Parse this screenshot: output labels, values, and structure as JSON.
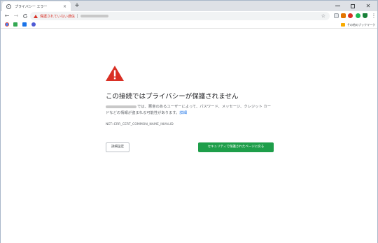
{
  "tab": {
    "title": "プライバシー エラー",
    "close": "×"
  },
  "new_tab": "+",
  "toolbar": {
    "back": "←",
    "forward": "→",
    "reload": "C",
    "security_text": "保護されていない通信",
    "star": "☆",
    "menu": "⋮"
  },
  "bookmarks": {
    "other_label": "その他のブックマーク"
  },
  "error": {
    "headline": "この接続ではプライバシーが保護されません",
    "description": "では、悪意のあるユーザーによって、パスワード、メッセージ、クレジット カードなどの情報が盗まれる可能性があります。",
    "detail_link": "詳細",
    "code": "NET::ERR_CERT_COMMON_NAME_INVALID",
    "details_button": "詳細設定",
    "back_button": "セキュリティで保護されたページに戻る"
  },
  "colors": {
    "warning_red": "#d93025",
    "primary_button": "#1e9e4a",
    "link": "#1a73e8"
  },
  "icons": {
    "tab_favicon": "globe-icon",
    "warning": "warning-triangle-icon",
    "bookmark_folder": "folder-icon"
  }
}
